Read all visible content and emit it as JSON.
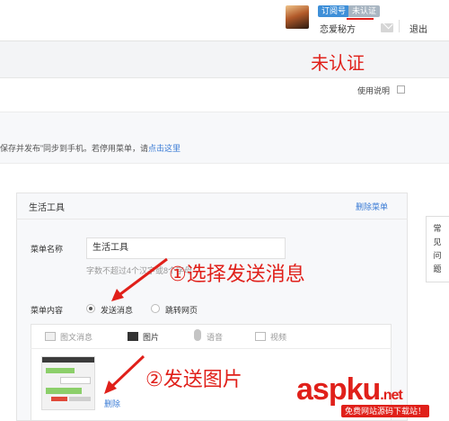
{
  "header": {
    "badge_subscription": "订阅号",
    "badge_unverified": "未认证",
    "account_name": "恋爱秘方",
    "logout": "退出"
  },
  "annotations": {
    "unverified": "未认证",
    "step1": "①选择发送消息",
    "step2": "②发送图片"
  },
  "main": {
    "help_link": "使用说明",
    "notice_text": "保存并发布”同步到手机。若停用菜单，请",
    "notice_link": "点击这里"
  },
  "editor": {
    "title": "生活工具",
    "delete_menu": "删除菜单",
    "name_label": "菜单名称",
    "name_value": "生活工具",
    "name_hint": "字数不超过4个汉字或8个字母",
    "content_label": "菜单内容",
    "content_options": [
      {
        "label": "发送消息",
        "selected": true
      },
      {
        "label": "跳转网页",
        "selected": false
      }
    ],
    "media_tabs": [
      {
        "label": "图文消息",
        "icon": "news-icon",
        "active": false
      },
      {
        "label": "图片",
        "icon": "image-icon",
        "active": true
      },
      {
        "label": "语音",
        "icon": "microphone-icon",
        "active": false
      },
      {
        "label": "视频",
        "icon": "video-icon",
        "active": false
      }
    ],
    "delete_image": "删除"
  },
  "faq": {
    "chars": [
      "常",
      "见",
      "问",
      "题"
    ]
  },
  "watermark": {
    "logo_main": "aspku",
    "logo_suffix": ".net",
    "tagline": "免费网站源码下载站！"
  },
  "colors": {
    "accent_red": "#e0201a",
    "link_blue": "#3a7bd5",
    "badge_blue": "#3e8fd8"
  }
}
